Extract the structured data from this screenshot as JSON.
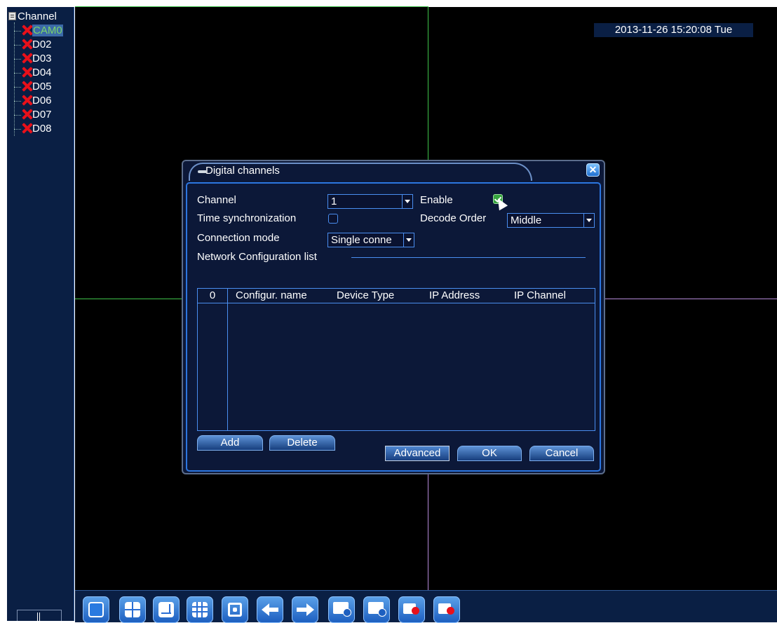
{
  "sidebar": {
    "root_label": "Channel",
    "items": [
      {
        "label": "CAM0",
        "selected": true
      },
      {
        "label": "D02"
      },
      {
        "label": "D03"
      },
      {
        "label": "D04"
      },
      {
        "label": "D05"
      },
      {
        "label": "D06"
      },
      {
        "label": "D07"
      },
      {
        "label": "D08"
      }
    ]
  },
  "video": {
    "timestamp": "2013-11-26 15:20:08 Tue"
  },
  "dialog": {
    "title": "Digital channels",
    "fields": {
      "channel_label": "Channel",
      "channel_value": "1",
      "enable_label": "Enable",
      "enable_checked": true,
      "time_sync_label": "Time synchronization",
      "time_sync_checked": false,
      "decode_order_label": "Decode Order",
      "decode_order_value": "Middle",
      "connection_mode_label": "Connection mode",
      "connection_mode_value": "Single conne"
    },
    "network_list": {
      "title": "Network Configuration list",
      "columns": [
        "0",
        "Configur. name",
        "Device Type",
        "IP Address",
        "IP Channel"
      ],
      "rows": []
    },
    "buttons": {
      "add": "Add",
      "delete": "Delete",
      "advanced": "Advanced",
      "ok": "OK",
      "cancel": "Cancel"
    }
  },
  "toolbar": {
    "icons": [
      "single-view-icon",
      "quad-view-icon",
      "multi-view-icon",
      "nine-grid-icon",
      "fullscreen-icon",
      "previous-icon",
      "next-icon",
      "playback-icon",
      "stop-playback-icon",
      "record-start-icon",
      "record-stop-icon"
    ]
  },
  "colors": {
    "panel_bg": "#0c1838",
    "accent_border": "#2c76e0",
    "selected_text": "#7cd66a",
    "error_red": "#e8101a",
    "grid_green": "#3ec24a",
    "grid_purple": "#b48ad8"
  }
}
